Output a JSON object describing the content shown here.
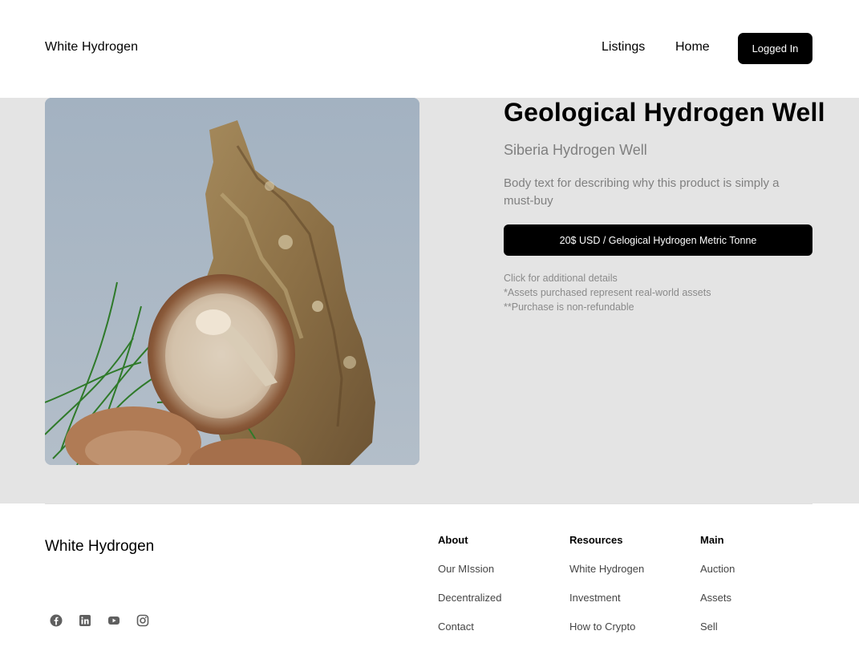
{
  "header": {
    "brand": "White Hydrogen",
    "nav": {
      "listings": "Listings",
      "home": "Home"
    },
    "login_label": "Logged In"
  },
  "product": {
    "image_icon": "mushroom-photo",
    "title": "Geological Hydrogen Well",
    "subtitle": "Siberia Hydrogen Well",
    "description": "Body text for describing why this product is simply a must-buy",
    "price_label": "20$ USD / Gelogical Hydrogen Metric Tonne",
    "notes": [
      "Click for additional details",
      "*Assets purchased represent real-world assets",
      "**Purchase is non-refundable"
    ]
  },
  "footer": {
    "brand": "White Hydrogen",
    "socials": [
      "facebook-icon",
      "linkedin-icon",
      "youtube-icon",
      "instagram-icon"
    ],
    "columns": [
      {
        "title": "About",
        "items": [
          "Our MIssion",
          "Decentralized",
          "Contact"
        ]
      },
      {
        "title": "Resources",
        "items": [
          "White Hydrogen",
          "Investment",
          "How to Crypto"
        ]
      },
      {
        "title": "Main",
        "items": [
          "Auction",
          "Assets",
          "Sell"
        ]
      }
    ]
  },
  "colors": {
    "hero_bg": "#e4e4e4",
    "button_bg": "#000000",
    "muted_text": "#808080"
  }
}
